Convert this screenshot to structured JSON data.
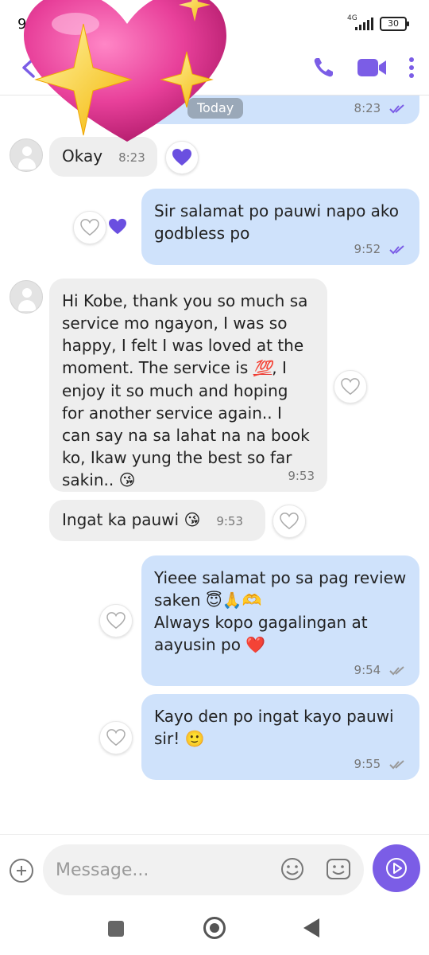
{
  "status_bar": {
    "time": "9",
    "network": "4G",
    "battery": "30"
  },
  "header": {
    "title": ""
  },
  "chat": {
    "today_label": "Today",
    "top_out_time": "8:23",
    "messages": [
      {
        "dir": "in",
        "text": "Okay",
        "time": "8:23"
      },
      {
        "dir": "out",
        "text": "Sir salamat po pauwi napo ako godbless po",
        "time": "9:52"
      },
      {
        "dir": "in",
        "text_a": "Hi Kobe, thank you so much sa service mo ngayon, I was so happy, I felt I was loved at the moment. The service is ",
        "emoji_100": "💯",
        "text_b": ", I enjoy it so much and hoping for another service again.. I can say na sa lahat na na book ko, Ikaw yung the best so far sakin.. ",
        "emoji_kiss": "😘",
        "time": "9:53"
      },
      {
        "dir": "in",
        "text": "Ingat ka pauwi ",
        "emoji": "😘",
        "time": "9:53"
      },
      {
        "dir": "out",
        "text_a": "Yieee salamat po sa pag review saken ",
        "emojis_a": "😇🙏🫶",
        "text_b": "Always kopo gagalingan at aayusin po ",
        "emoji_b": "❤️",
        "time": "9:54"
      },
      {
        "dir": "out",
        "text": "Kayo den po ingat kayo pauwi sir! ",
        "emoji": "🙂",
        "time": "9:55"
      }
    ]
  },
  "composer": {
    "placeholder": "Message..."
  },
  "colors": {
    "accent": "#7b5de6",
    "bubble_out": "#cfe2fb",
    "bubble_in": "#eeeeee",
    "heart": "#e8409a"
  },
  "icons": [
    "back-arrow-icon",
    "phone-icon",
    "video-icon",
    "more-icon",
    "heart-icon",
    "plus-icon",
    "smile-icon",
    "sticker-icon",
    "send-icon"
  ]
}
